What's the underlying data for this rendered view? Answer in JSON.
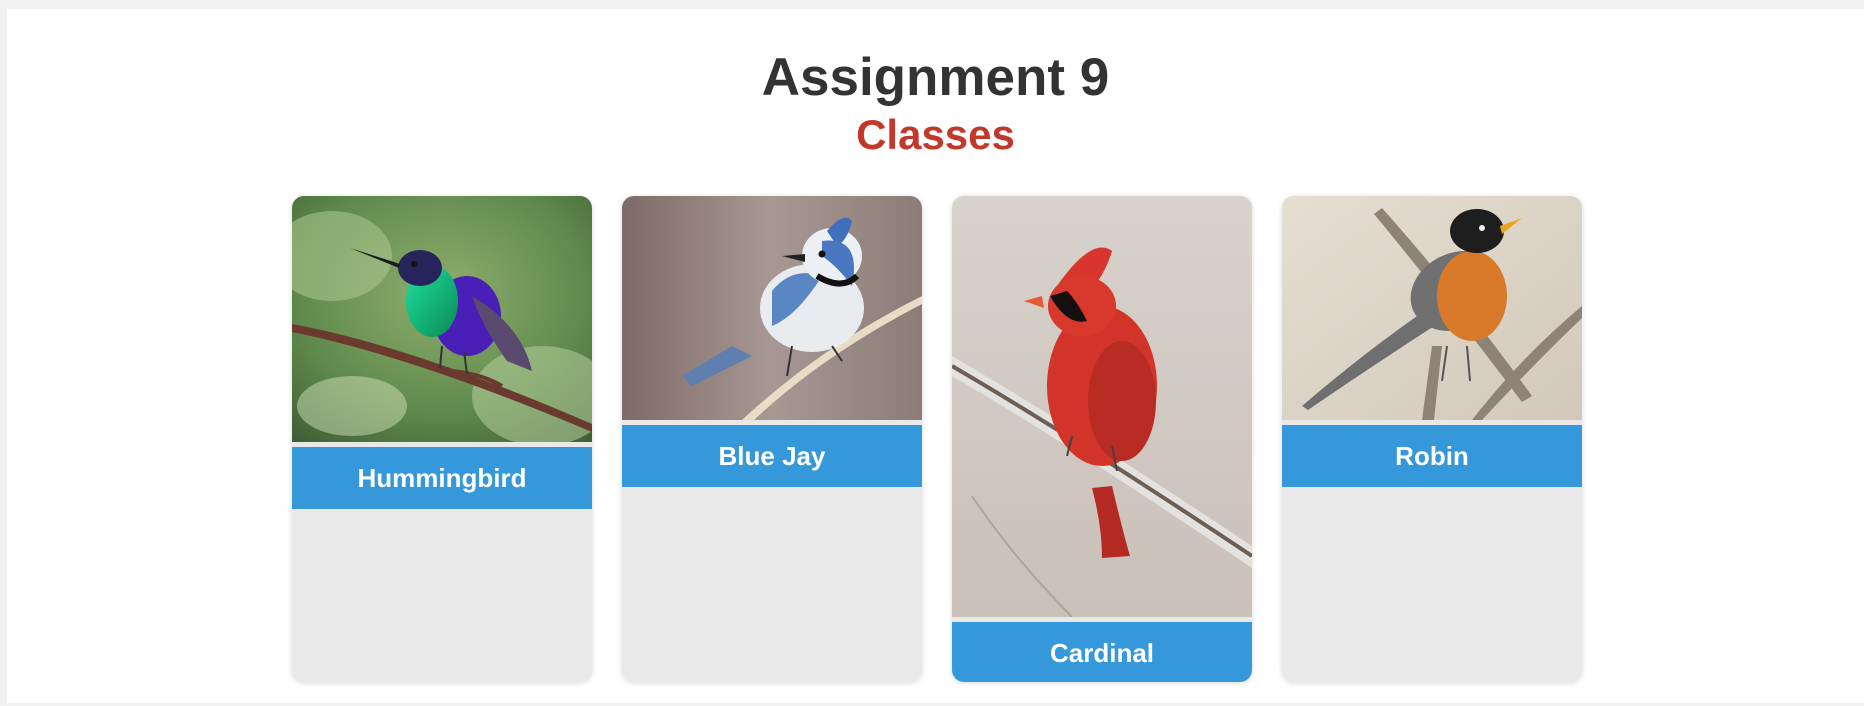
{
  "header": {
    "title": "Assignment 9",
    "subtitle": "Classes"
  },
  "colors": {
    "title": "#333333",
    "subtitle": "#c0392b",
    "label_bg": "#3498db",
    "card_bg": "#e9e9e9"
  },
  "cards": [
    {
      "label": "Hummingbird",
      "icon": "hummingbird-photo"
    },
    {
      "label": "Blue Jay",
      "icon": "blue-jay-photo"
    },
    {
      "label": "Cardinal",
      "icon": "cardinal-photo"
    },
    {
      "label": "Robin",
      "icon": "robin-photo"
    }
  ]
}
